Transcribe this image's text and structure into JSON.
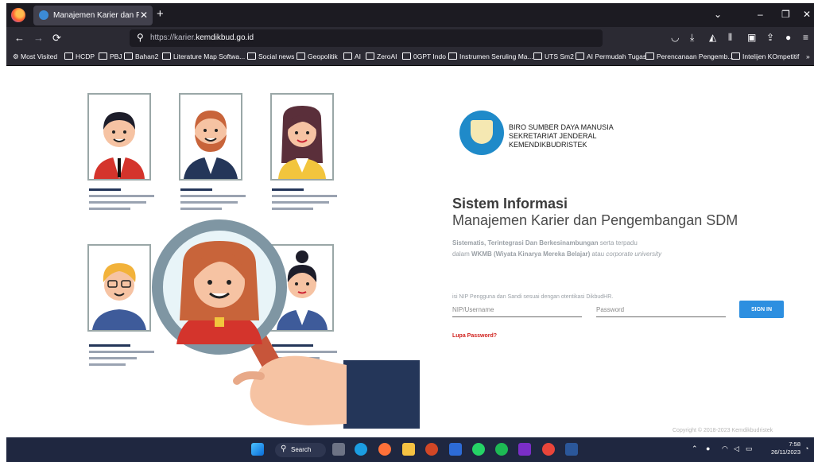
{
  "browser": {
    "tab_title": "Manajemen Karier dan Pengem",
    "new_tab": "+",
    "close": "✕",
    "url_prefix": "https://karier.",
    "url_domain": "kemdikbud.go.id",
    "window": {
      "chevron": "⌄",
      "minimize": "–",
      "restore": "❐",
      "close": "✕"
    }
  },
  "bookmarks": [
    "Most Visited",
    "HCDP",
    "PBJ",
    "Bahan2",
    "Literature Map Softwa...",
    "Social news",
    "Geopolitik",
    "AI",
    "ZeroAI",
    "0GPT Indo",
    "Instrumen Seruling Ma...",
    "UTS Sm2",
    "AI Permudah Tugas",
    "Perencanaan Pengemb...",
    "Intelijen KOmpetitif"
  ],
  "org": {
    "line1": "BIRO SUMBER DAYA MANUSIA",
    "line2": "SEKRETARIAT JENDERAL",
    "line3": "KEMENDIKBUDRISTEK"
  },
  "main": {
    "title": "Sistem Informasi",
    "subtitle": "Manajemen Karier dan Pengembangan SDM",
    "desc1_bold": "Sistematis, Terintegrasi Dan Berkesinambungan",
    "desc1_rest": " serta terpadu",
    "desc2_pre": "dalam ",
    "desc2_bold": "WKMB (Wiyata Kinarya Mereka Belajar)",
    "desc2_mid": " atau ",
    "desc2_italic": "corporate university",
    "hint": "isi NIP Pengguna dan Sandi sesuai dengan otentikasi DikbudHR.",
    "username_placeholder": "NIP/Username",
    "password_placeholder": "Password",
    "signin_label": "SIGN IN",
    "forgot_label": "Lupa Password?",
    "copyright": "Copyright © 2018-2023 Kemdikbudristek"
  },
  "taskbar": {
    "search_label": "Search",
    "time": "7:58",
    "date": "26/11/2023"
  }
}
